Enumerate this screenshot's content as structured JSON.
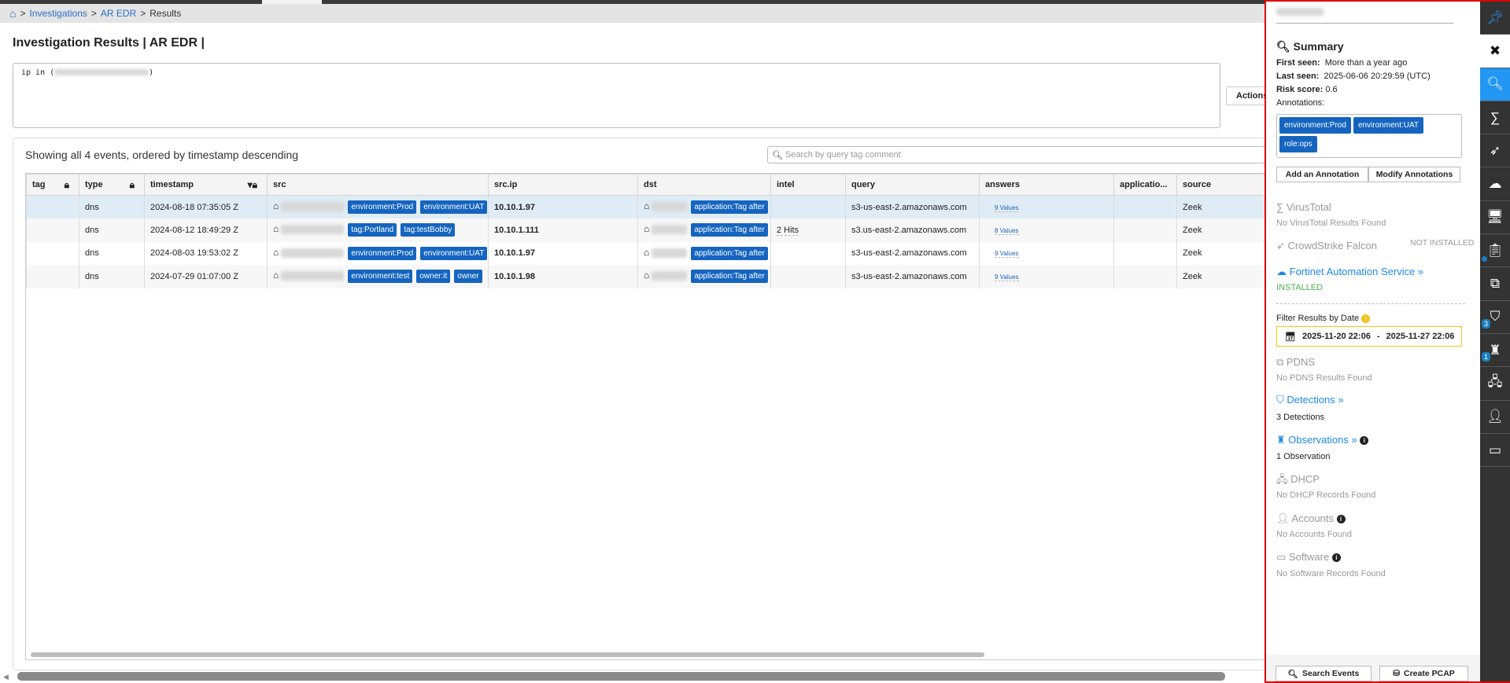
{
  "breadcrumb": {
    "items": [
      "Investigations",
      "AR EDR",
      "Results"
    ],
    "sep": ">"
  },
  "page": {
    "title": "Investigation Results | AR EDR |",
    "query_prefix": "ip in (",
    "query_suffix": ")",
    "actions_label": "Actions"
  },
  "results": {
    "summary": "Showing all 4 events, ordered by timestamp descending",
    "search_placeholder": "Search by query tag comment",
    "columns": [
      "tag",
      "type",
      "timestamp",
      "src",
      "src.ip",
      "dst",
      "intel",
      "query",
      "answers",
      "applicatio...",
      "source"
    ],
    "rows": [
      {
        "type": "dns",
        "timestamp": "2024-08-18 07:35:05 Z",
        "src_tags": [
          "environment:Prod",
          "environment:UAT"
        ],
        "src_ip": "10.10.1.97",
        "dst_tags": [
          "application:Tag after"
        ],
        "intel": "",
        "query": "s3-us-east-2.amazonaws.com",
        "answers": "9 Values",
        "source": "Zeek"
      },
      {
        "type": "dns",
        "timestamp": "2024-08-12 18:49:29 Z",
        "src_tags": [
          "tag:Portland",
          "tag:testBobby"
        ],
        "src_ip": "10.10.1.111",
        "dst_tags": [
          "application:Tag after"
        ],
        "intel": "2 Hits",
        "query": "s3.us-east-2.amazonaws.com",
        "answers": "8 Values",
        "source": "Zeek"
      },
      {
        "type": "dns",
        "timestamp": "2024-08-03 19:53:02 Z",
        "src_tags": [
          "environment:Prod",
          "environment:UAT"
        ],
        "src_ip": "10.10.1.97",
        "dst_tags": [
          "application:Tag after"
        ],
        "intel": "",
        "query": "s3-us-east-2.amazonaws.com",
        "answers": "9 Values",
        "source": "Zeek"
      },
      {
        "type": "dns",
        "timestamp": "2024-07-29 01:07:00 Z",
        "src_tags": [
          "environment:test",
          "owner:it",
          "owner"
        ],
        "src_ip": "10.10.1.98",
        "dst_tags": [
          "application:Tag after"
        ],
        "intel": "",
        "query": "s3-us-east-2.amazonaws.com",
        "answers": "9 Values",
        "source": "Zeek"
      }
    ]
  },
  "panel": {
    "summary_title": "Summary",
    "first_seen_label": "First seen:",
    "first_seen": "More than a year ago",
    "last_seen_label": "Last seen:",
    "last_seen": "2025-06-06 20:29:59 (UTC)",
    "risk_label": "Risk score:",
    "risk": "0.6",
    "annotations_label": "Annotations:",
    "annotations": [
      "environment:Prod",
      "environment:UAT",
      "role:ops"
    ],
    "add_annotation": "Add an Annotation",
    "modify_annotations": "Modify Annotations",
    "virustotal": "VirusTotal",
    "virustotal_sub": "No VirusTotal Results Found",
    "crowdstrike": "CrowdStrike Falcon",
    "crowdstrike_status": "NOT INSTALLED",
    "fortinet": "Fortinet Automation Service »",
    "fortinet_status": "INSTALLED",
    "filter_label": "Filter Results by Date",
    "date_from": "2025-11-20 22:06",
    "date_sep": "-",
    "date_to": "2025-11-27 22:06",
    "pdns": "PDNS",
    "pdns_sub": "No PDNS Results Found",
    "detections": "Detections »",
    "detections_sub": "3 Detections",
    "observations": "Observations »",
    "observations_sub": "1 Observation",
    "dhcp": "DHCP",
    "dhcp_sub": "No DHCP Records Found",
    "accounts": "Accounts",
    "accounts_sub": "No Accounts Found",
    "software": "Software",
    "software_sub": "No Software Records Found",
    "search_events": "Search Events",
    "create_pcap": "Create PCAP"
  },
  "iconbar": {
    "detections_badge": "3",
    "observations_badge": "1"
  },
  "colors": {
    "tag_blue": "#1565c0",
    "link_blue": "#1e88e5",
    "active_blue": "#2196f3",
    "installed_green": "#4caf50",
    "panel_border": "#e00000"
  }
}
